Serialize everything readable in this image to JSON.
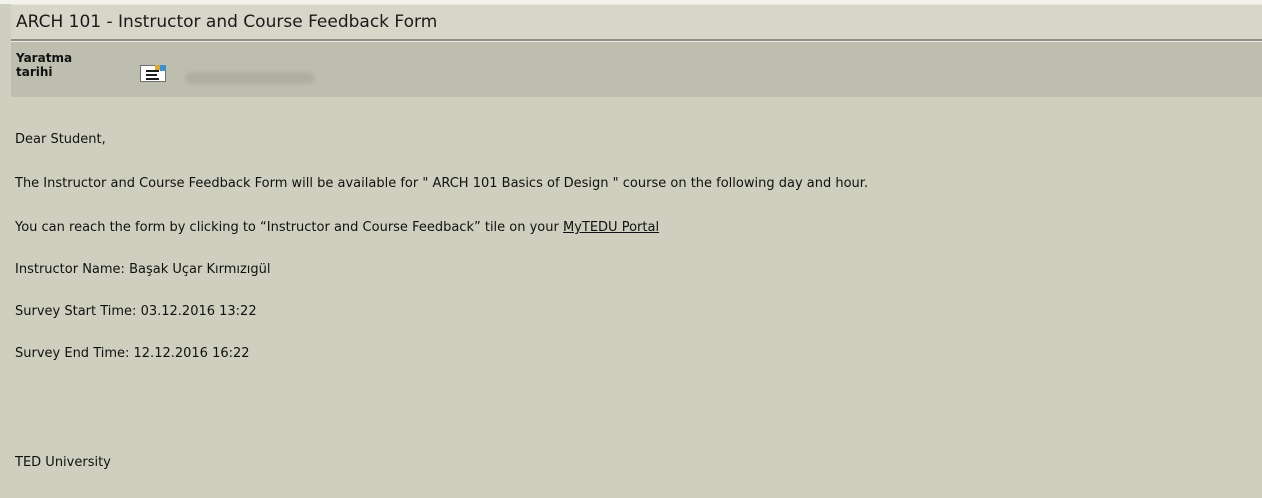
{
  "window": {
    "title": "ARCH 101 - Instructor and Course Feedback Form"
  },
  "meta": {
    "created_label": "Yaratma tarihi",
    "calendar_icon": "calendar-icon"
  },
  "message": {
    "greeting": "Dear Student,",
    "availability": "The Instructor and Course Feedback Form will be available for \" ARCH 101 Basics of Design \" course on the following day and hour.",
    "reach_prefix": "You can reach the form by clicking to “Instructor and Course Feedback” tile on your ",
    "portal_link": "MyTEDU Portal",
    "instructor": "Instructor Name: Başak Uçar Kırmızıgül",
    "start_time": "Survey Start Time: 03.12.2016 13:22",
    "end_time": "Survey End Time: 12.12.2016 16:22",
    "signature": "TED University"
  },
  "colors": {
    "page_background": "#cfcfbf",
    "title_bar": "#d7d6c9",
    "meta_bar": "#bebeb0"
  }
}
